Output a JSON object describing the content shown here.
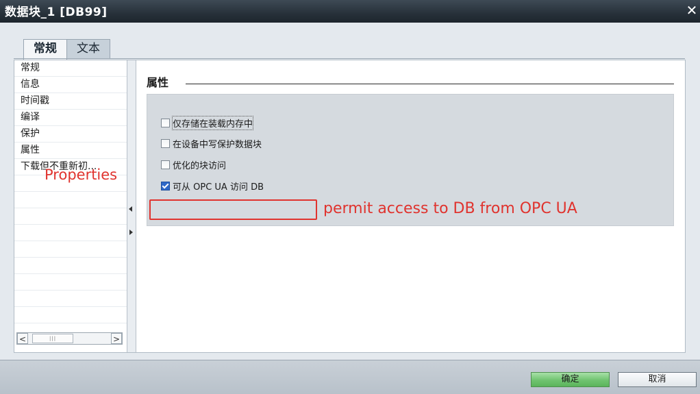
{
  "window": {
    "title": "数据块_1 [DB99]",
    "close_glyph": "✕"
  },
  "tabs": [
    {
      "label": "常规",
      "active": true
    },
    {
      "label": "文本",
      "active": false
    }
  ],
  "nav": {
    "items": [
      {
        "label": "常规"
      },
      {
        "label": "信息"
      },
      {
        "label": "时间戳"
      },
      {
        "label": "编译"
      },
      {
        "label": "保护"
      },
      {
        "label": "属性",
        "selected": true
      },
      {
        "label": "下载但不重新初..."
      }
    ],
    "scroll_left": "<",
    "scroll_right": ">",
    "scroll_grip": "|||"
  },
  "section": {
    "title": "属性"
  },
  "options": [
    {
      "label": "仅存储在装载内存中",
      "checked": false
    },
    {
      "label": "在设备中写保护数据块",
      "checked": false
    },
    {
      "label": "优化的块访问",
      "checked": false
    },
    {
      "label": "可从 OPC UA 访问 DB",
      "checked": true
    }
  ],
  "annotations": {
    "properties": "Properties",
    "opc_ua": "permit access to DB from OPC UA",
    "color": "#e0332e"
  },
  "footer": {
    "ok_label": "确定",
    "cancel_label": "取消"
  },
  "colors": {
    "titlebar": "#27313a",
    "ok_button": "#6fc36f",
    "checkbox_checked": "#2f68c7"
  }
}
